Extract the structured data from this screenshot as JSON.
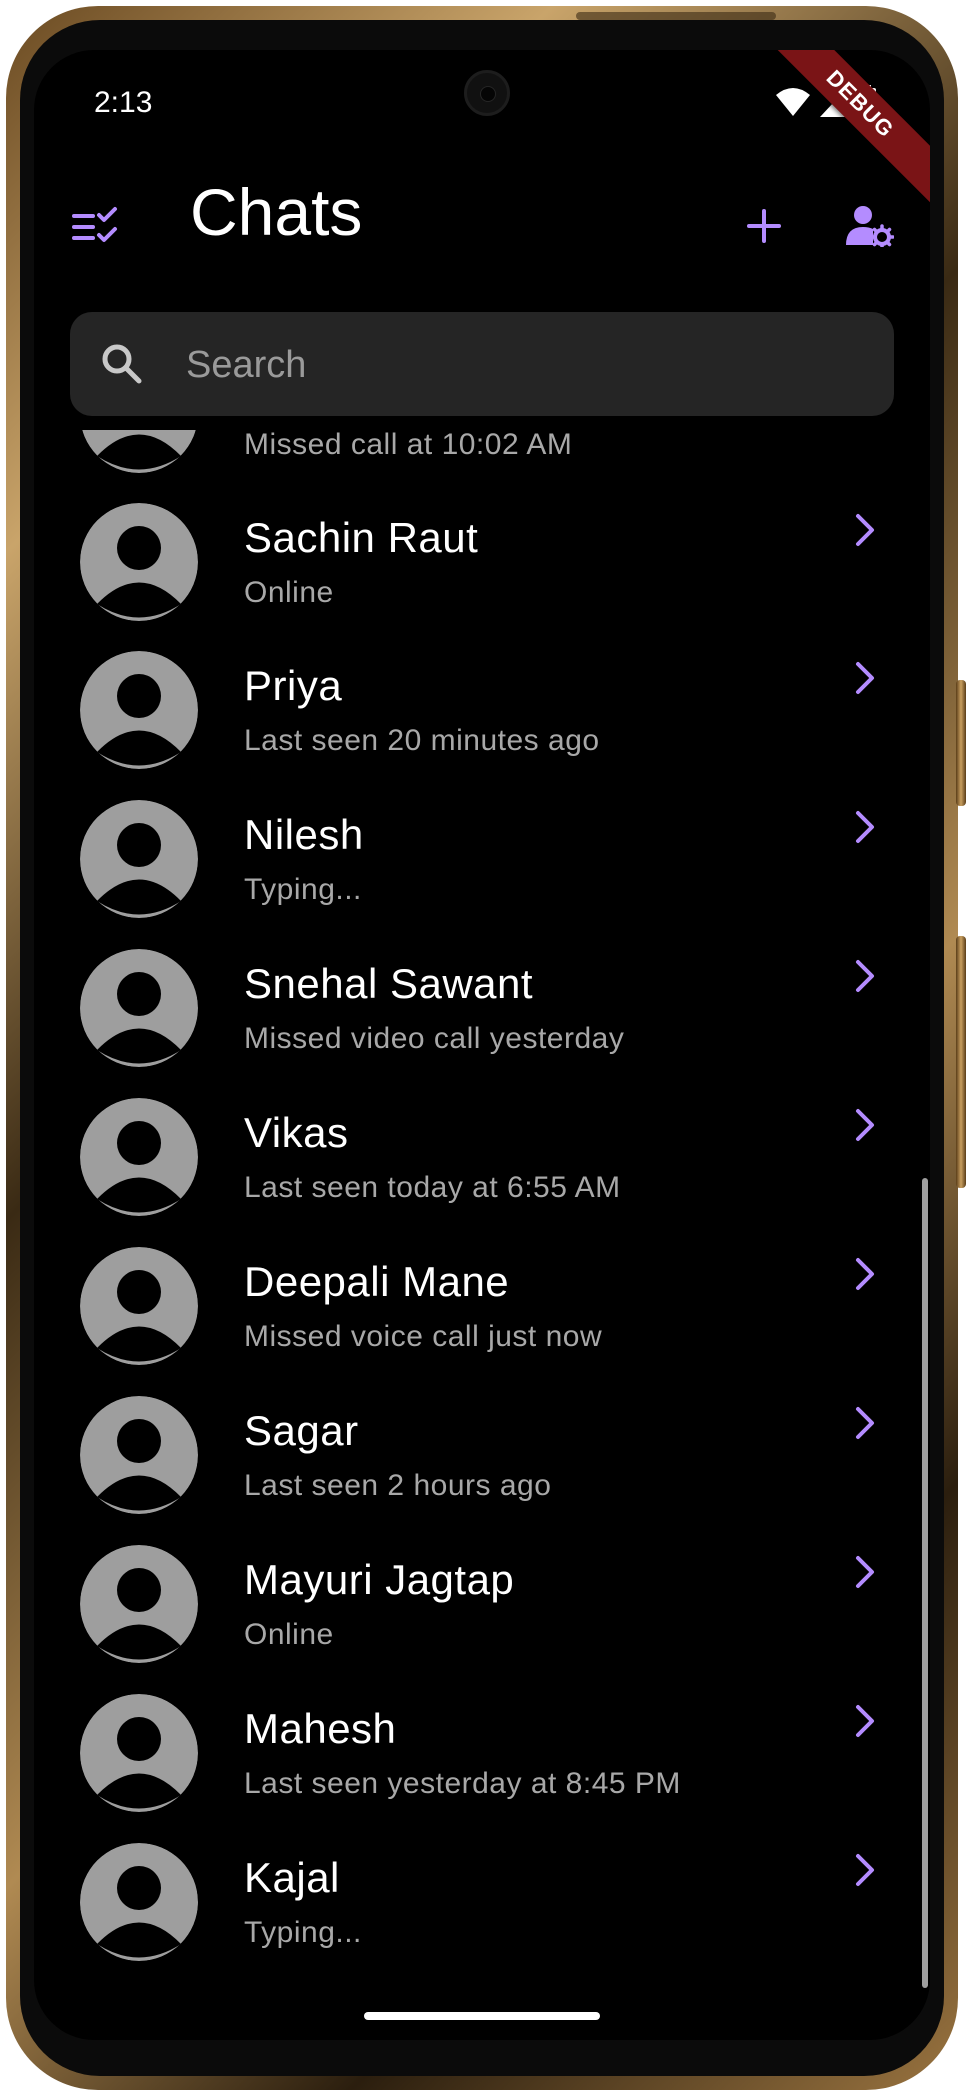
{
  "status_bar": {
    "time": "2:13",
    "debug_label": "DEBUG"
  },
  "header": {
    "title": "Chats"
  },
  "search": {
    "placeholder": "Search",
    "value": ""
  },
  "colors": {
    "accent": "#b48cff",
    "background": "#000000",
    "avatar": "#9e9e9e",
    "search_bg": "#252525"
  },
  "icons": {
    "select": "checklist-icon",
    "add": "plus-icon",
    "settings": "manage-accounts-icon",
    "search": "search-icon",
    "chevron": "chevron-right-icon",
    "avatar": "person-icon"
  },
  "chats": [
    {
      "name": "",
      "status": "Missed call at 10:02 AM"
    },
    {
      "name": "Sachin Raut",
      "status": "Online"
    },
    {
      "name": "Priya",
      "status": "Last seen 20 minutes ago"
    },
    {
      "name": "Nilesh",
      "status": "Typing..."
    },
    {
      "name": "Snehal Sawant",
      "status": "Missed video call yesterday"
    },
    {
      "name": "Vikas",
      "status": "Last seen today at 6:55 AM"
    },
    {
      "name": "Deepali Mane",
      "status": "Missed voice call just now"
    },
    {
      "name": "Sagar",
      "status": "Last seen 2 hours ago"
    },
    {
      "name": "Mayuri Jagtap",
      "status": "Online"
    },
    {
      "name": "Mahesh",
      "status": "Last seen yesterday at 8:45 PM"
    },
    {
      "name": "Kajal",
      "status": "Typing..."
    }
  ]
}
